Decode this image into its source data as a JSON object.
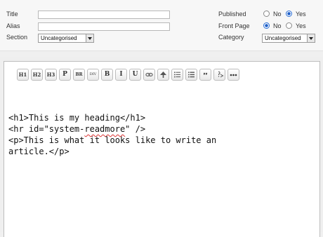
{
  "form": {
    "title_label": "Title",
    "title_value": "",
    "alias_label": "Alias",
    "alias_value": "",
    "section_label": "Section",
    "section_value": "Uncategorised",
    "published_label": "Published",
    "published_no": "No",
    "published_yes": "Yes",
    "published_selected": "Yes",
    "frontpage_label": "Front Page",
    "frontpage_no": "No",
    "frontpage_yes": "Yes",
    "frontpage_selected": "No",
    "category_label": "Category",
    "category_value": "Uncategorised"
  },
  "toolbar": {
    "buttons": [
      "H1",
      "H2",
      "H3",
      "P",
      "BR",
      "DIV",
      "B",
      "I",
      "U",
      "link",
      "tree",
      "list",
      "list-numbered",
      "quote",
      "php",
      "more"
    ]
  },
  "editor": {
    "line1": "<h1>This is my heading</h1>",
    "line2_a": "<hr id=\"system-",
    "line2_b": "readmore",
    "line2_c": "\" />",
    "line3": "<p>This is what it looks like to write an",
    "line4": "article.</p>"
  }
}
